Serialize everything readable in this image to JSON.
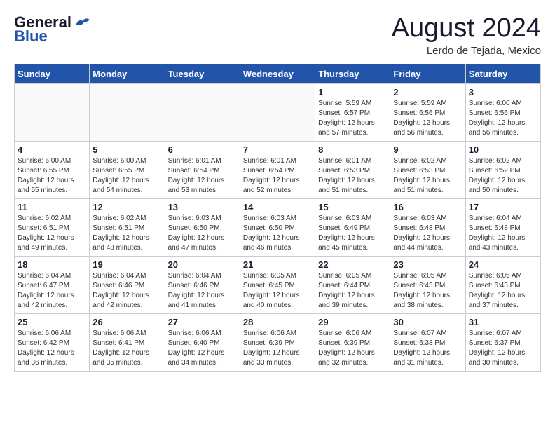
{
  "logo": {
    "line1": "General",
    "line2": "Blue"
  },
  "title": "August 2024",
  "location": "Lerdo de Tejada, Mexico",
  "days_of_week": [
    "Sunday",
    "Monday",
    "Tuesday",
    "Wednesday",
    "Thursday",
    "Friday",
    "Saturday"
  ],
  "weeks": [
    [
      {
        "day": "",
        "info": ""
      },
      {
        "day": "",
        "info": ""
      },
      {
        "day": "",
        "info": ""
      },
      {
        "day": "",
        "info": ""
      },
      {
        "day": "1",
        "info": "Sunrise: 5:59 AM\nSunset: 6:57 PM\nDaylight: 12 hours\nand 57 minutes."
      },
      {
        "day": "2",
        "info": "Sunrise: 5:59 AM\nSunset: 6:56 PM\nDaylight: 12 hours\nand 56 minutes."
      },
      {
        "day": "3",
        "info": "Sunrise: 6:00 AM\nSunset: 6:56 PM\nDaylight: 12 hours\nand 56 minutes."
      }
    ],
    [
      {
        "day": "4",
        "info": "Sunrise: 6:00 AM\nSunset: 6:55 PM\nDaylight: 12 hours\nand 55 minutes."
      },
      {
        "day": "5",
        "info": "Sunrise: 6:00 AM\nSunset: 6:55 PM\nDaylight: 12 hours\nand 54 minutes."
      },
      {
        "day": "6",
        "info": "Sunrise: 6:01 AM\nSunset: 6:54 PM\nDaylight: 12 hours\nand 53 minutes."
      },
      {
        "day": "7",
        "info": "Sunrise: 6:01 AM\nSunset: 6:54 PM\nDaylight: 12 hours\nand 52 minutes."
      },
      {
        "day": "8",
        "info": "Sunrise: 6:01 AM\nSunset: 6:53 PM\nDaylight: 12 hours\nand 51 minutes."
      },
      {
        "day": "9",
        "info": "Sunrise: 6:02 AM\nSunset: 6:53 PM\nDaylight: 12 hours\nand 51 minutes."
      },
      {
        "day": "10",
        "info": "Sunrise: 6:02 AM\nSunset: 6:52 PM\nDaylight: 12 hours\nand 50 minutes."
      }
    ],
    [
      {
        "day": "11",
        "info": "Sunrise: 6:02 AM\nSunset: 6:51 PM\nDaylight: 12 hours\nand 49 minutes."
      },
      {
        "day": "12",
        "info": "Sunrise: 6:02 AM\nSunset: 6:51 PM\nDaylight: 12 hours\nand 48 minutes."
      },
      {
        "day": "13",
        "info": "Sunrise: 6:03 AM\nSunset: 6:50 PM\nDaylight: 12 hours\nand 47 minutes."
      },
      {
        "day": "14",
        "info": "Sunrise: 6:03 AM\nSunset: 6:50 PM\nDaylight: 12 hours\nand 46 minutes."
      },
      {
        "day": "15",
        "info": "Sunrise: 6:03 AM\nSunset: 6:49 PM\nDaylight: 12 hours\nand 45 minutes."
      },
      {
        "day": "16",
        "info": "Sunrise: 6:03 AM\nSunset: 6:48 PM\nDaylight: 12 hours\nand 44 minutes."
      },
      {
        "day": "17",
        "info": "Sunrise: 6:04 AM\nSunset: 6:48 PM\nDaylight: 12 hours\nand 43 minutes."
      }
    ],
    [
      {
        "day": "18",
        "info": "Sunrise: 6:04 AM\nSunset: 6:47 PM\nDaylight: 12 hours\nand 42 minutes."
      },
      {
        "day": "19",
        "info": "Sunrise: 6:04 AM\nSunset: 6:46 PM\nDaylight: 12 hours\nand 42 minutes."
      },
      {
        "day": "20",
        "info": "Sunrise: 6:04 AM\nSunset: 6:46 PM\nDaylight: 12 hours\nand 41 minutes."
      },
      {
        "day": "21",
        "info": "Sunrise: 6:05 AM\nSunset: 6:45 PM\nDaylight: 12 hours\nand 40 minutes."
      },
      {
        "day": "22",
        "info": "Sunrise: 6:05 AM\nSunset: 6:44 PM\nDaylight: 12 hours\nand 39 minutes."
      },
      {
        "day": "23",
        "info": "Sunrise: 6:05 AM\nSunset: 6:43 PM\nDaylight: 12 hours\nand 38 minutes."
      },
      {
        "day": "24",
        "info": "Sunrise: 6:05 AM\nSunset: 6:43 PM\nDaylight: 12 hours\nand 37 minutes."
      }
    ],
    [
      {
        "day": "25",
        "info": "Sunrise: 6:06 AM\nSunset: 6:42 PM\nDaylight: 12 hours\nand 36 minutes."
      },
      {
        "day": "26",
        "info": "Sunrise: 6:06 AM\nSunset: 6:41 PM\nDaylight: 12 hours\nand 35 minutes."
      },
      {
        "day": "27",
        "info": "Sunrise: 6:06 AM\nSunset: 6:40 PM\nDaylight: 12 hours\nand 34 minutes."
      },
      {
        "day": "28",
        "info": "Sunrise: 6:06 AM\nSunset: 6:39 PM\nDaylight: 12 hours\nand 33 minutes."
      },
      {
        "day": "29",
        "info": "Sunrise: 6:06 AM\nSunset: 6:39 PM\nDaylight: 12 hours\nand 32 minutes."
      },
      {
        "day": "30",
        "info": "Sunrise: 6:07 AM\nSunset: 6:38 PM\nDaylight: 12 hours\nand 31 minutes."
      },
      {
        "day": "31",
        "info": "Sunrise: 6:07 AM\nSunset: 6:37 PM\nDaylight: 12 hours\nand 30 minutes."
      }
    ]
  ]
}
